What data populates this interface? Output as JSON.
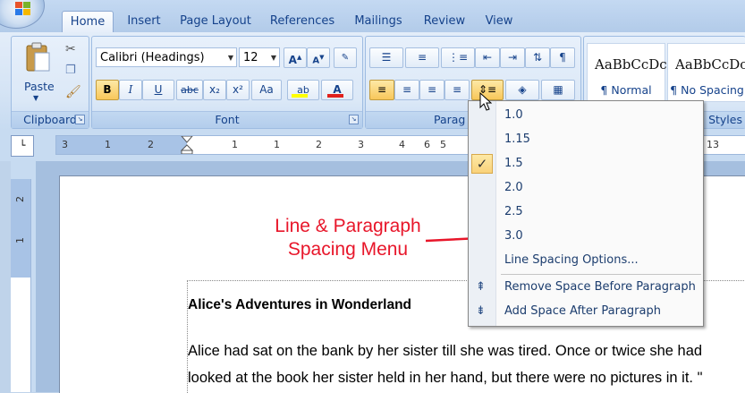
{
  "tabs": [
    "Home",
    "Insert",
    "Page Layout",
    "References",
    "Mailings",
    "Review",
    "View"
  ],
  "clipboard": {
    "group_label": "Clipboard",
    "paste_label": "Paste"
  },
  "font": {
    "group_label": "Font",
    "family": "Calibri (Headings)",
    "size": "12",
    "grow_label": "A",
    "shrink_label": "A",
    "bold": "B",
    "italic": "I",
    "underline": "U",
    "strikethrough": "abc",
    "subscript": "x₂",
    "superscript": "x²",
    "case": "Aa"
  },
  "paragraph": {
    "group_label": "Parag"
  },
  "styles": {
    "group_label": "Styles",
    "items": [
      {
        "preview": "AaBbCcDc",
        "name": "¶ Normal"
      },
      {
        "preview": "AaBbCcDc",
        "name": "¶ No Spacing"
      }
    ]
  },
  "ruler": {
    "ticks": [
      "3",
      "1",
      "2",
      "1",
      "1",
      "2",
      "3",
      "4",
      "5",
      "6",
      "13"
    ]
  },
  "vruler": {
    "ticks": [
      "2",
      "1"
    ]
  },
  "line_spacing_menu": {
    "options": [
      "1.0",
      "1.15",
      "1.5",
      "2.0",
      "2.5",
      "3.0"
    ],
    "selected": "1.5",
    "check_glyph": "✓",
    "options_label": "Line Spacing Options...",
    "remove_before": "Remove Space Before Paragraph",
    "add_after": "Add Space After Paragraph"
  },
  "annotation": {
    "line1": "Line & Paragraph",
    "line2": "Spacing Menu",
    "color": "#e8162a"
  },
  "document": {
    "title": "Alice's Adventures in Wonderland",
    "line1": "Alice had sat on the bank by her sister till she was tired. Once or twice she had",
    "line2": "looked at the book her sister held in her hand, but there were no pictures in it. \""
  }
}
